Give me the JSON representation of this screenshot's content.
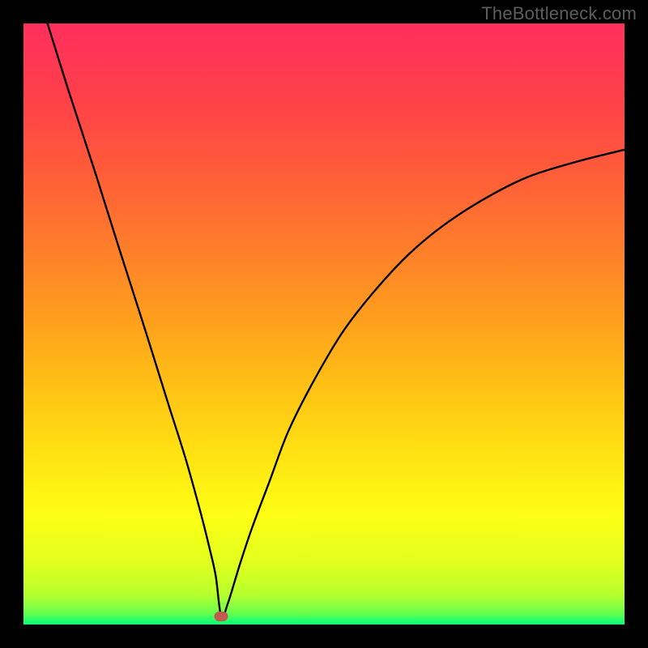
{
  "watermark": "TheBottleneck.com",
  "chart_data": {
    "type": "line",
    "title": "",
    "xlabel": "",
    "ylabel": "",
    "xlim": [
      0,
      100
    ],
    "ylim": [
      0,
      100
    ],
    "grid": false,
    "series": [
      {
        "name": "curve",
        "x": [
          4,
          7.6,
          12,
          16,
          20,
          24,
          27,
          29.5,
          31,
          32,
          32.9,
          34,
          36,
          38,
          41,
          44,
          48,
          53,
          58,
          64,
          70,
          77,
          84,
          92,
          100
        ],
        "values": [
          100,
          88.5,
          75,
          62.3,
          49.8,
          37,
          27.5,
          18.5,
          12.5,
          8,
          1.3,
          3.5,
          10,
          16,
          24,
          32,
          40,
          48.5,
          55,
          61.5,
          66.5,
          71,
          74.5,
          77,
          79
        ]
      }
    ],
    "marker": {
      "x": 32.9,
      "y": 1.3,
      "color": "#c35a4e"
    }
  }
}
